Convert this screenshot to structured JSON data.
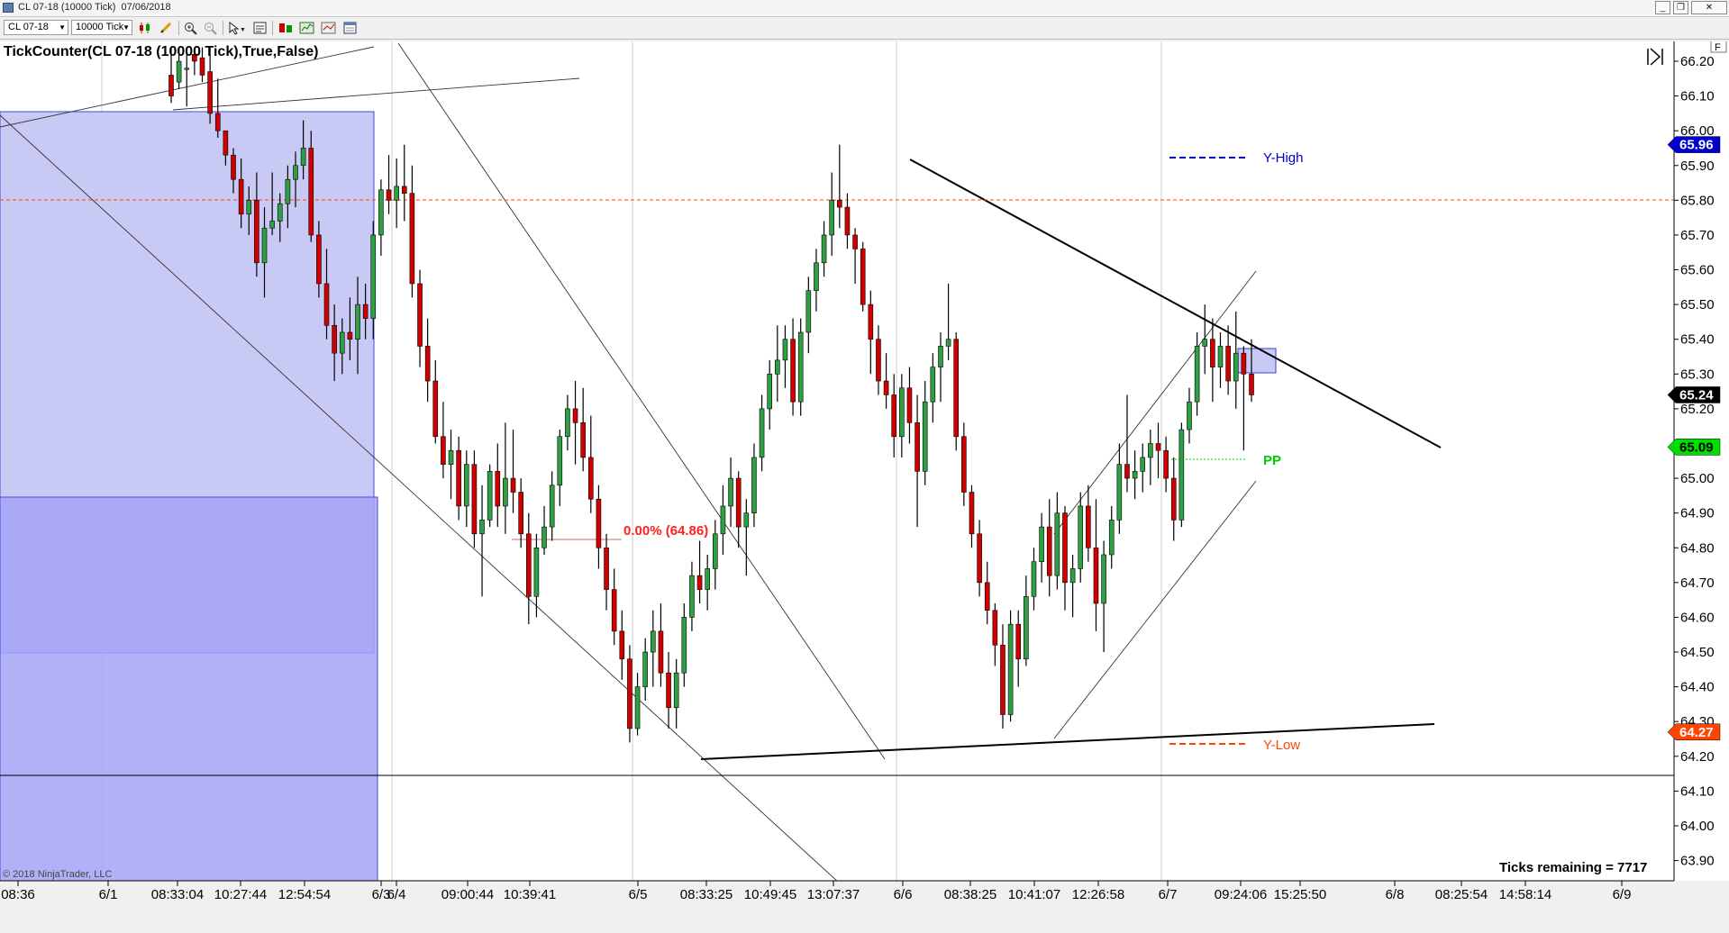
{
  "window": {
    "title": "CL 07-18 (10000 Tick)  07/06/2018",
    "buttons": [
      "minimize",
      "restore",
      "close"
    ]
  },
  "toolbar": {
    "instrument": "CL 07-18",
    "interval": "10000 Tick",
    "icons": [
      "candlestick-style-icon",
      "draw-pencil-icon",
      "zoom-in-icon",
      "zoom-out-icon",
      "pointer-icon",
      "data-box-icon",
      "bar-style-icon",
      "indicators-icon",
      "strategies-icon",
      "properties-icon"
    ]
  },
  "chart": {
    "indicator_label": "TickCounter(CL 07-18 (10000 Tick),True,False)",
    "copyright": "© 2018 NinjaTrader, LLC",
    "ticks_remaining": "Ticks remaining = 7717",
    "fib_label": "0.00% (64.86)",
    "legend": {
      "y_high": "Y-High",
      "y_low": "Y-Low",
      "pp": "PP"
    },
    "price_markers": {
      "y_high": "65.96",
      "last": "65.24",
      "pp": "65.09",
      "y_low": "64.27"
    },
    "panel_button": "F",
    "colors": {
      "up_candle": "#2ea043",
      "down_candle": "#d10000",
      "y_high": "#0000cc",
      "y_low": "#ff4500",
      "pp": "#00cc00",
      "zone_fill": "#c8c8f5"
    }
  },
  "chart_data": {
    "type": "candlestick",
    "title": "",
    "y_axis": {
      "ticks": [
        "66.20",
        "66.10",
        "66.00",
        "65.90",
        "65.80",
        "65.70",
        "65.60",
        "65.50",
        "65.40",
        "65.30",
        "65.20",
        "65.10",
        "65.00",
        "64.90",
        "64.80",
        "64.70",
        "64.60",
        "64.50",
        "64.40",
        "64.30",
        "64.20",
        "64.10",
        "64.00",
        "63.90"
      ],
      "range": [
        63.88,
        66.24
      ]
    },
    "x_axis": {
      "labels": [
        "08:36",
        "6/1",
        "08:33:04",
        "10:27:44",
        "12:54:54",
        "6/3",
        "6/4",
        "09:00:44",
        "10:39:41",
        "6/5",
        "08:33:25",
        "10:49:45",
        "13:07:37",
        "6/6",
        "08:38:25",
        "10:41:07",
        "12:26:58",
        "6/7",
        "09:24:06",
        "15:25:50",
        "6/8",
        "08:25:54",
        "14:58:14",
        "6/9"
      ]
    },
    "horizontal_levels": {
      "y_high": 65.96,
      "y_low": 64.27,
      "pp": 65.09,
      "last": 65.24,
      "dashed_level": 65.84,
      "solid_level": 64.18
    },
    "candles": [
      [
        66.16,
        66.24,
        66.08,
        66.1
      ],
      [
        66.14,
        66.24,
        66.12,
        66.2
      ],
      [
        66.18,
        66.24,
        66.07,
        66.18
      ],
      [
        66.22,
        66.24,
        66.16,
        66.2
      ],
      [
        66.21,
        66.24,
        66.14,
        66.16
      ],
      [
        66.17,
        66.24,
        66.02,
        66.05
      ],
      [
        66.05,
        66.15,
        65.98,
        66.0
      ],
      [
        66.0,
        66.0,
        65.9,
        65.93
      ],
      [
        65.93,
        65.95,
        65.82,
        65.86
      ],
      [
        65.86,
        65.92,
        65.72,
        65.76
      ],
      [
        65.76,
        65.84,
        65.7,
        65.8
      ],
      [
        65.8,
        65.88,
        65.58,
        65.62
      ],
      [
        65.62,
        65.78,
        65.52,
        65.72
      ],
      [
        65.72,
        65.88,
        65.7,
        65.74
      ],
      [
        65.74,
        65.82,
        65.68,
        65.79
      ],
      [
        65.79,
        65.9,
        65.72,
        65.86
      ],
      [
        65.86,
        65.94,
        65.78,
        65.9
      ],
      [
        65.9,
        66.03,
        65.86,
        65.95
      ],
      [
        65.95,
        66.0,
        65.68,
        65.7
      ],
      [
        65.7,
        65.74,
        65.52,
        65.56
      ],
      [
        65.56,
        65.66,
        65.4,
        65.44
      ],
      [
        65.44,
        65.5,
        65.28,
        65.36
      ],
      [
        65.36,
        65.46,
        65.3,
        65.42
      ],
      [
        65.42,
        65.52,
        65.34,
        65.4
      ],
      [
        65.4,
        65.58,
        65.3,
        65.5
      ],
      [
        65.5,
        65.56,
        65.4,
        65.46
      ],
      [
        65.46,
        65.74,
        65.4,
        65.7
      ],
      [
        65.7,
        65.86,
        65.64,
        65.83
      ],
      [
        65.83,
        65.93,
        65.76,
        65.8
      ],
      [
        65.8,
        65.92,
        65.72,
        65.84
      ],
      [
        65.84,
        65.96,
        65.74,
        65.82
      ],
      [
        65.82,
        65.9,
        65.52,
        65.56
      ],
      [
        65.56,
        65.6,
        65.32,
        65.38
      ],
      [
        65.38,
        65.46,
        65.22,
        65.28
      ],
      [
        65.28,
        65.34,
        65.1,
        65.12
      ],
      [
        65.12,
        65.22,
        65.0,
        65.04
      ],
      [
        65.04,
        65.14,
        64.94,
        65.08
      ],
      [
        65.08,
        65.12,
        64.88,
        64.92
      ],
      [
        64.92,
        65.08,
        64.86,
        65.04
      ],
      [
        65.04,
        65.08,
        64.8,
        64.84
      ],
      [
        64.84,
        64.98,
        64.66,
        64.88
      ],
      [
        64.88,
        65.04,
        64.86,
        65.02
      ],
      [
        65.02,
        65.1,
        64.86,
        64.92
      ],
      [
        64.92,
        65.16,
        64.84,
        65.0
      ],
      [
        65.0,
        65.14,
        64.9,
        64.96
      ],
      [
        64.96,
        65.0,
        64.8,
        64.84
      ],
      [
        64.84,
        64.9,
        64.58,
        64.66
      ],
      [
        64.66,
        64.84,
        64.6,
        64.8
      ],
      [
        64.8,
        64.92,
        64.78,
        64.86
      ],
      [
        64.86,
        65.02,
        64.82,
        64.98
      ],
      [
        64.98,
        65.14,
        64.92,
        65.12
      ],
      [
        65.12,
        65.24,
        65.08,
        65.2
      ],
      [
        65.2,
        65.28,
        65.04,
        65.16
      ],
      [
        65.16,
        65.26,
        65.02,
        65.06
      ],
      [
        65.06,
        65.18,
        64.9,
        64.94
      ],
      [
        64.94,
        64.98,
        64.74,
        64.8
      ],
      [
        64.8,
        64.84,
        64.62,
        64.68
      ],
      [
        64.68,
        64.74,
        64.52,
        64.56
      ],
      [
        64.56,
        64.62,
        64.42,
        64.48
      ],
      [
        64.48,
        64.52,
        64.24,
        64.28
      ],
      [
        64.28,
        64.44,
        64.26,
        64.4
      ],
      [
        64.4,
        64.54,
        64.36,
        64.5
      ],
      [
        64.5,
        64.62,
        64.4,
        64.56
      ],
      [
        64.56,
        64.64,
        64.4,
        64.44
      ],
      [
        64.44,
        64.5,
        64.28,
        64.34
      ],
      [
        64.34,
        64.48,
        64.28,
        64.44
      ],
      [
        64.44,
        64.64,
        64.4,
        64.6
      ],
      [
        64.6,
        64.76,
        64.56,
        64.72
      ],
      [
        64.72,
        64.82,
        64.64,
        64.68
      ],
      [
        64.68,
        64.78,
        64.62,
        64.74
      ],
      [
        64.74,
        64.88,
        64.68,
        64.84
      ],
      [
        64.84,
        64.98,
        64.78,
        64.92
      ],
      [
        64.92,
        65.06,
        64.86,
        65.0
      ],
      [
        65.0,
        65.02,
        64.8,
        64.86
      ],
      [
        64.86,
        64.94,
        64.72,
        64.9
      ],
      [
        64.9,
        65.1,
        64.86,
        65.06
      ],
      [
        65.06,
        65.24,
        65.02,
        65.2
      ],
      [
        65.2,
        65.34,
        65.14,
        65.3
      ],
      [
        65.3,
        65.44,
        65.22,
        65.34
      ],
      [
        65.34,
        65.44,
        65.26,
        65.4
      ],
      [
        65.4,
        65.46,
        65.18,
        65.22
      ],
      [
        65.22,
        65.46,
        65.18,
        65.42
      ],
      [
        65.42,
        65.58,
        65.36,
        65.54
      ],
      [
        65.54,
        65.66,
        65.48,
        65.62
      ],
      [
        65.62,
        65.74,
        65.58,
        65.7
      ],
      [
        65.7,
        65.88,
        65.64,
        65.8
      ],
      [
        65.8,
        65.96,
        65.72,
        65.78
      ],
      [
        65.78,
        65.82,
        65.66,
        65.7
      ],
      [
        65.7,
        65.72,
        65.56,
        65.66
      ],
      [
        65.66,
        65.68,
        65.48,
        65.5
      ],
      [
        65.5,
        65.54,
        65.3,
        65.4
      ],
      [
        65.4,
        65.44,
        65.24,
        65.28
      ],
      [
        65.28,
        65.36,
        65.2,
        65.24
      ],
      [
        65.24,
        65.3,
        65.06,
        65.12
      ],
      [
        65.12,
        65.3,
        65.06,
        65.26
      ],
      [
        65.26,
        65.32,
        65.1,
        65.16
      ],
      [
        65.16,
        65.24,
        64.86,
        65.02
      ],
      [
        65.02,
        65.28,
        64.98,
        65.22
      ],
      [
        65.22,
        65.36,
        65.16,
        65.32
      ],
      [
        65.32,
        65.42,
        65.22,
        65.38
      ],
      [
        65.38,
        65.56,
        65.34,
        65.4
      ],
      [
        65.4,
        65.42,
        65.08,
        65.12
      ],
      [
        65.12,
        65.16,
        64.92,
        64.96
      ],
      [
        64.96,
        64.98,
        64.8,
        64.84
      ],
      [
        64.84,
        64.88,
        64.66,
        64.7
      ],
      [
        64.7,
        64.76,
        64.58,
        64.62
      ],
      [
        64.62,
        64.64,
        64.46,
        64.52
      ],
      [
        64.52,
        64.58,
        64.28,
        64.32
      ],
      [
        64.32,
        64.62,
        64.3,
        64.58
      ],
      [
        64.58,
        64.62,
        64.4,
        64.48
      ],
      [
        64.48,
        64.72,
        64.46,
        64.66
      ],
      [
        64.66,
        64.8,
        64.62,
        64.76
      ],
      [
        64.76,
        64.9,
        64.7,
        64.86
      ],
      [
        64.86,
        64.94,
        64.66,
        64.72
      ],
      [
        64.72,
        64.96,
        64.68,
        64.9
      ],
      [
        64.9,
        64.92,
        64.62,
        64.7
      ],
      [
        64.7,
        64.78,
        64.6,
        64.74
      ],
      [
        64.74,
        64.96,
        64.7,
        64.92
      ],
      [
        64.92,
        64.98,
        64.76,
        64.8
      ],
      [
        64.8,
        64.94,
        64.56,
        64.64
      ],
      [
        64.64,
        64.82,
        64.5,
        64.78
      ],
      [
        64.78,
        64.92,
        64.74,
        64.88
      ],
      [
        64.88,
        65.1,
        64.84,
        65.04
      ],
      [
        65.04,
        65.24,
        64.96,
        65.0
      ],
      [
        65.0,
        65.08,
        64.94,
        65.02
      ],
      [
        65.02,
        65.1,
        64.96,
        65.06
      ],
      [
        65.06,
        65.14,
        64.98,
        65.1
      ],
      [
        65.1,
        65.16,
        65.0,
        65.08
      ],
      [
        65.08,
        65.12,
        64.96,
        65.0
      ],
      [
        65.0,
        65.06,
        64.82,
        64.88
      ],
      [
        64.88,
        65.16,
        64.86,
        65.14
      ],
      [
        65.14,
        65.26,
        65.1,
        65.22
      ],
      [
        65.22,
        65.42,
        65.18,
        65.38
      ],
      [
        65.38,
        65.5,
        65.3,
        65.4
      ],
      [
        65.4,
        65.46,
        65.22,
        65.32
      ],
      [
        65.32,
        65.42,
        65.26,
        65.38
      ],
      [
        65.38,
        65.44,
        65.24,
        65.28
      ],
      [
        65.28,
        65.48,
        65.2,
        65.36
      ],
      [
        65.36,
        65.38,
        65.08,
        65.3
      ],
      [
        65.3,
        65.4,
        65.22,
        65.24
      ]
    ]
  }
}
